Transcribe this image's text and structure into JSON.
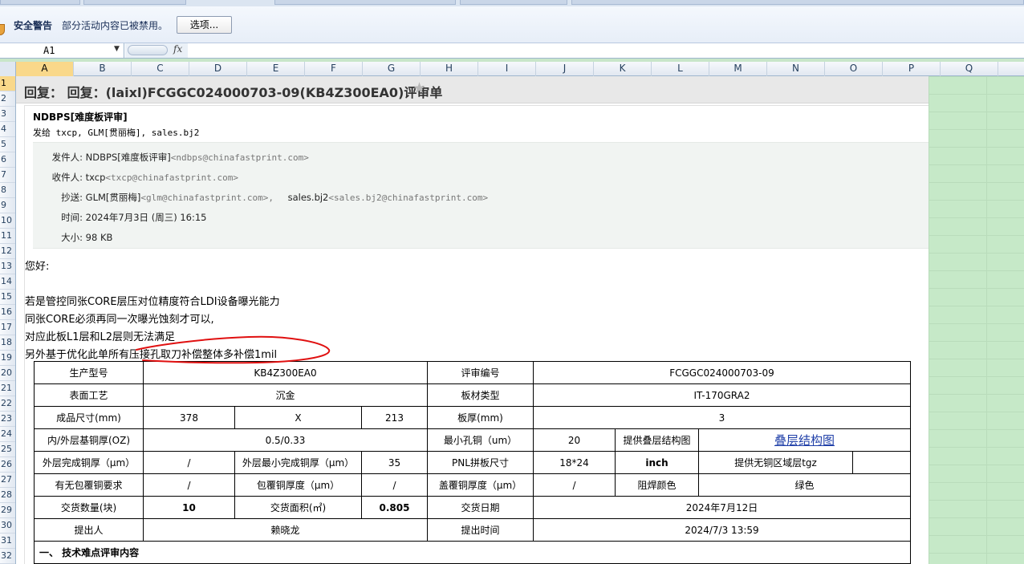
{
  "security_bar": {
    "title": "安全警告",
    "message": "部分活动内容已被禁用。",
    "options_button": "选项..."
  },
  "formula_bar": {
    "name_box": "A1",
    "fx_label": "fx",
    "value": ""
  },
  "columns": [
    "A",
    "B",
    "C",
    "D",
    "E",
    "F",
    "G",
    "H",
    "I",
    "J",
    "K",
    "L",
    "M",
    "N",
    "O",
    "P",
    "Q"
  ],
  "rows": [
    "1",
    "2",
    "3",
    "4",
    "5",
    "6",
    "7",
    "8",
    "9",
    "10",
    "11",
    "12",
    "13",
    "14",
    "15",
    "16",
    "17",
    "18",
    "19",
    "20",
    "21",
    "22",
    "23",
    "24",
    "25",
    "26",
    "27",
    "28",
    "29",
    "30",
    "31",
    "32"
  ],
  "email": {
    "subject": "回复：  回复：(laixl)FCGGC024000703-09(KB4Z300EA0)评审单",
    "sender": "NDBPS[难度板评审]",
    "send_to": "发给 txcp, GLM[贯丽梅], sales.bj2",
    "from_label": "发件人:",
    "from_name": "NDBPS[难度板评审]",
    "from_email": "<ndbps@chinafastprint.com>",
    "to_label": "收件人:",
    "to_name": "txcp",
    "to_email": "<txcp@chinafastprint.com>",
    "cc_label": "抄送:",
    "cc_name1": "GLM[贯丽梅]",
    "cc_email1": "<glm@chinafastprint.com>,",
    "cc_name2": "sales.bj2",
    "cc_email2": "<sales.bj2@chinafastprint.com>",
    "time_label": "时间:",
    "time_value": "2024年7月3日 (周三) 16:15",
    "size_label": "大小:",
    "size_value": "98 KB",
    "greeting": "您好:",
    "line1": "若是管控同张CORE层压对位精度符合LDI设备曝光能力",
    "line2": "同张CORE必须再同一次曝光蚀刻才可以,",
    "line3": "对应此板L1层和L2层则无法满足",
    "line4": "另外基于优化此单所有压接孔取刀补偿整体多补偿1mil"
  },
  "spec_table": {
    "r1": [
      "生产型号",
      "KB4Z300EA0",
      "评审编号",
      "FCGGC024000703-09"
    ],
    "r2": [
      "表面工艺",
      "沉金",
      "板材类型",
      "IT-170GRA2"
    ],
    "r3": [
      "成品尺寸(mm)",
      "378",
      "X",
      "213",
      "板厚(mm)",
      "3"
    ],
    "r4": [
      "内/外层基铜厚(OZ)",
      "0.5/0.33",
      "最小孔铜（um）",
      "20",
      "提供叠层结构图",
      "叠层结构图"
    ],
    "r5": [
      "外层完成铜厚（μm）",
      "/",
      "外层最小完成铜厚（μm）",
      "35",
      "PNL拼板尺寸",
      "18*24",
      "inch",
      "提供无铜区域层tgz",
      ""
    ],
    "r6": [
      "有无包覆铜要求",
      "/",
      "包覆铜厚度（μm）",
      "/",
      "盖覆铜厚度（μm）",
      "/",
      "阻焊颜色",
      "绿色"
    ],
    "r7": [
      "交货数量(块)",
      "10",
      "交货面积(㎡)",
      "0.805",
      "交货日期",
      "2024年7月12日"
    ],
    "r8": [
      "提出人",
      "赖晓龙",
      "提出时间",
      "2024/7/3 13:59"
    ],
    "section": "一、 技术难点评审内容"
  },
  "colors": {
    "accent_green": "#c6e9c8",
    "header_selected": "#f9d88a",
    "annotation_red": "#e01010",
    "link_blue": "#1f3fa8"
  }
}
